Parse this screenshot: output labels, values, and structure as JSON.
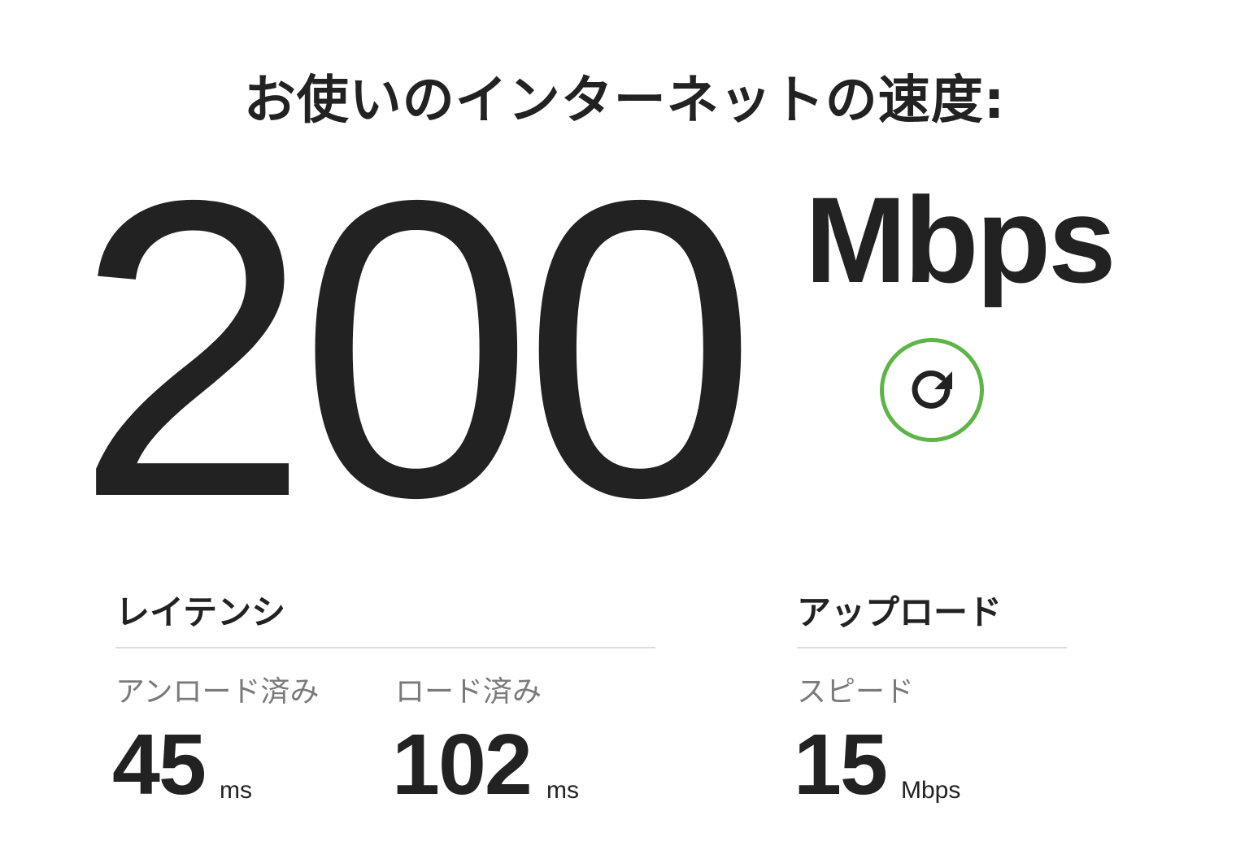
{
  "header": {
    "title": "お使いのインターネットの速度:"
  },
  "download": {
    "value": "200",
    "unit": "Mbps"
  },
  "refresh": {
    "icon": "refresh-icon",
    "accent_color": "#5cb546"
  },
  "latency": {
    "title": "レイテンシ",
    "unloaded": {
      "label": "アンロード済み",
      "value": "45",
      "unit": "ms"
    },
    "loaded": {
      "label": "ロード済み",
      "value": "102",
      "unit": "ms"
    }
  },
  "upload": {
    "title": "アップロード",
    "speed": {
      "label": "スピード",
      "value": "15",
      "unit": "Mbps"
    }
  }
}
